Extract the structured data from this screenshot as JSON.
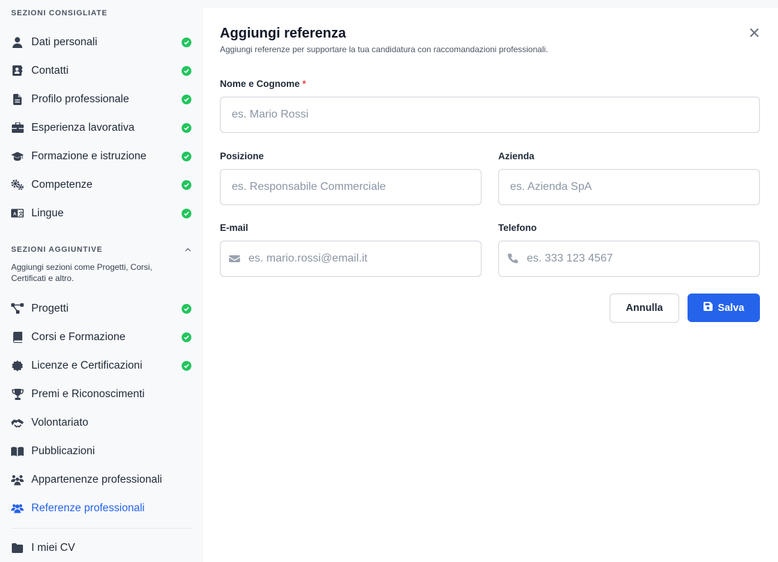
{
  "sidebar": {
    "recommended_heading": "SEZIONI CONSIGLIATE",
    "recommended": [
      {
        "label": "Dati personali",
        "icon": "user-icon",
        "done": true
      },
      {
        "label": "Contatti",
        "icon": "address-card-icon",
        "done": true
      },
      {
        "label": "Profilo professionale",
        "icon": "document-icon",
        "done": true
      },
      {
        "label": "Esperienza lavorativa",
        "icon": "briefcase-icon",
        "done": true
      },
      {
        "label": "Formazione e istruzione",
        "icon": "graduation-cap-icon",
        "done": true
      },
      {
        "label": "Competenze",
        "icon": "gears-icon",
        "done": true
      },
      {
        "label": "Lingue",
        "icon": "language-icon",
        "done": true
      }
    ],
    "additional_heading": "SEZIONI AGGIUNTIVE",
    "additional_description": "Aggiungi sezioni come Progetti, Corsi, Certificati e altro.",
    "additional": [
      {
        "label": "Progetti",
        "icon": "diagram-icon",
        "done": true
      },
      {
        "label": "Corsi e Formazione",
        "icon": "book-icon",
        "done": true
      },
      {
        "label": "Licenze e Certificazioni",
        "icon": "certificate-icon",
        "done": true
      },
      {
        "label": "Premi e Riconoscimenti",
        "icon": "trophy-icon",
        "done": false
      },
      {
        "label": "Volontariato",
        "icon": "handshake-icon",
        "done": false
      },
      {
        "label": "Pubblicazioni",
        "icon": "open-book-icon",
        "done": false
      },
      {
        "label": "Appartenenze professionali",
        "icon": "people-group-icon",
        "done": false
      },
      {
        "label": "Referenze professionali",
        "icon": "users-icon",
        "done": false,
        "active": true
      }
    ],
    "footer_item": {
      "label": "I miei CV",
      "icon": "folder-icon"
    }
  },
  "modal": {
    "title": "Aggiungi referenza",
    "subtitle": "Aggiungi referenze per supportare la tua candidatura con raccomandazioni professionali.",
    "fields": {
      "name": {
        "label": "Nome e Cognome",
        "required_mark": "*",
        "placeholder": "es. Mario Rossi",
        "value": ""
      },
      "position": {
        "label": "Posizione",
        "placeholder": "es. Responsabile Commerciale",
        "value": ""
      },
      "company": {
        "label": "Azienda",
        "placeholder": "es. Azienda SpA",
        "value": ""
      },
      "email": {
        "label": "E-mail",
        "placeholder": "es. mario.rossi@email.it",
        "value": "",
        "icon": "envelope-icon"
      },
      "phone": {
        "label": "Telefono",
        "placeholder": "es. 333 123 4567",
        "value": "",
        "icon": "phone-icon"
      }
    },
    "cancel_label": "Annulla",
    "save_label": "Salva"
  },
  "colors": {
    "accent": "#2563eb",
    "success": "#22c55e",
    "required": "#ef4444"
  }
}
